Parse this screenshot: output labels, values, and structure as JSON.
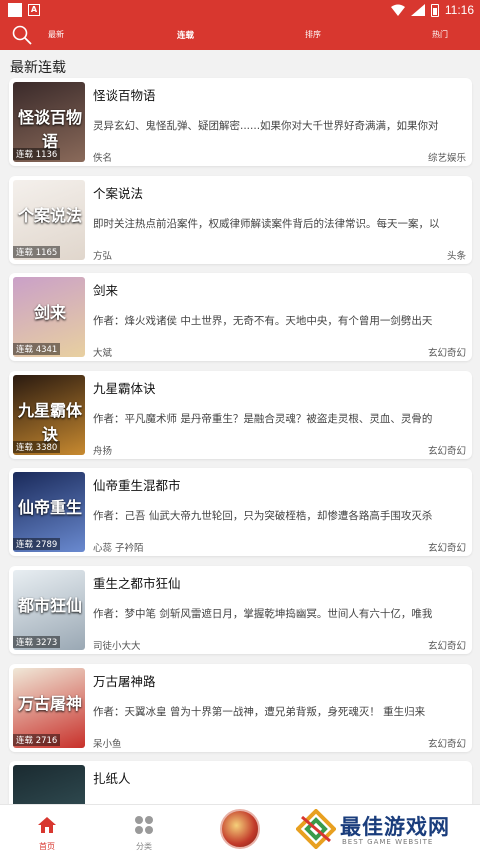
{
  "status": {
    "time": "11:16",
    "notif_letter": "A"
  },
  "header": {
    "tabs": [
      {
        "label": "最新",
        "active": false
      },
      {
        "label": "连载",
        "active": true
      },
      {
        "label": "排序",
        "active": false
      },
      {
        "label": "热门",
        "active": false
      }
    ]
  },
  "section_title": "最新连载",
  "books": [
    {
      "title": "怪谈百物语",
      "desc": "灵异玄幻、鬼怪乱弹、疑团解密......如果你对大千世界好奇满满，如果你对",
      "author": "佚名",
      "category": "综艺娱乐",
      "badge": "连载 1136",
      "cover_text": "怪谈百物语",
      "cover_colors": [
        "#3a2a2a",
        "#8a6a5a"
      ]
    },
    {
      "title": "个案说法",
      "desc": "即时关注热点前沿案件，权威律师解读案件背后的法律常识。每天一案，以",
      "author": "方弘",
      "category": "头条",
      "badge": "连载 1165",
      "cover_text": "个案说法",
      "cover_colors": [
        "#f4f0ec",
        "#e0d6cc"
      ]
    },
    {
      "title": "剑来",
      "desc": "作者：烽火戏诸侯 中土世界，无奇不有。天地中央，有个曾用一剑劈出天",
      "author": "大斌",
      "category": "玄幻奇幻",
      "badge": "连载 4341",
      "cover_text": "剑来",
      "cover_colors": [
        "#caa0c8",
        "#e8d0a0"
      ]
    },
    {
      "title": "九星霸体诀",
      "desc": "作者：平凡魔术师 是丹帝重生？是融合灵魂？被盗走灵根、灵血、灵骨的",
      "author": "舟扬",
      "category": "玄幻奇幻",
      "badge": "连载 3380",
      "cover_text": "九星霸体诀",
      "cover_colors": [
        "#2a1a10",
        "#c88a30"
      ]
    },
    {
      "title": "仙帝重生混都市",
      "desc": "作者：己吾 仙武大帝九世轮回，只为突破桎梏，却惨遭各路高手围攻灭杀",
      "author": "心蕊 子衿陌",
      "category": "玄幻奇幻",
      "badge": "连载 2789",
      "cover_text": "仙帝重生",
      "cover_colors": [
        "#1a2a5a",
        "#6a8ad0"
      ]
    },
    {
      "title": "重生之都市狂仙",
      "desc": "作者：梦中笔 剑斩风雷遮日月，掌握乾坤捣幽冥。世间人有六十亿，唯我",
      "author": "司徒小大大",
      "category": "玄幻奇幻",
      "badge": "连载 3273",
      "cover_text": "都市狂仙",
      "cover_colors": [
        "#e8eef2",
        "#9aa8b4"
      ]
    },
    {
      "title": "万古屠神路",
      "desc": "作者：天翼冰皇 曾为十界第一战神，遭兄弟背叛，身死魂灭！ 重生归来",
      "author": "呆小鱼",
      "category": "玄幻奇幻",
      "badge": "连载 2716",
      "cover_text": "万古屠神",
      "cover_colors": [
        "#f0e8d8",
        "#c8302a"
      ]
    },
    {
      "title": "扎纸人",
      "desc": "",
      "author": "",
      "category": "",
      "badge": "",
      "cover_text": "",
      "cover_colors": [
        "#1a2a30",
        "#3a5a60"
      ]
    }
  ],
  "bottom_nav": [
    {
      "label": "首页",
      "icon": "home-icon",
      "active": true
    },
    {
      "label": "分类",
      "icon": "grid-icon",
      "active": false
    }
  ],
  "watermark": {
    "title": "最佳游戏网",
    "sub": "BEST GAME WEBSITE"
  },
  "colors": {
    "accent": "#d8372f",
    "card": "#ffffff",
    "background": "#f2f2f2"
  }
}
